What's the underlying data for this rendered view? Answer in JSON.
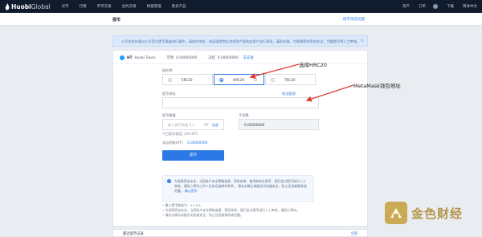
{
  "brand": {
    "name": "Huobi",
    "name_suffix": "Global"
  },
  "nav": {
    "items": [
      "买币",
      "行情",
      "币币交易",
      "合约交易",
      "财富管理",
      "更多产品"
    ],
    "right": [
      "资产",
      "订单",
      "下载",
      "简体中文"
    ]
  },
  "page": {
    "title": "提币",
    "help_link": "提币常见问题"
  },
  "notice": {
    "text": "火币仅支持通过火币官方提币渠道进行操作，请核对地址，若因填错地址造成资产损失由用户自行承担，谨防诈骗，为保障您的资金安全，大额提币将人工审核。"
  },
  "coin": {
    "symbol": "HT",
    "name": "Huobi Token",
    "available_label": "可用",
    "available_value": "0.00000000",
    "frozen_label": "冻结",
    "frozen_value": "0.00000000",
    "recharge_link": "去充值"
  },
  "form": {
    "chain_label": "链名称",
    "chains": [
      {
        "label": "ERC20",
        "selected": false
      },
      {
        "label": "HRC20",
        "selected": true
      },
      {
        "label": "TRC20",
        "selected": false
      }
    ],
    "address_label": "提币地址",
    "address_manage": "地址管理",
    "address_placeholder": "",
    "amount_label": "提币数量",
    "amount_placeholder": "最小提币数量 0.2",
    "amount_all": "全部",
    "amount_unit": "HT",
    "fee_label": "手续费",
    "fee_value": "0.00000000",
    "quota_label": "今日剩余额度",
    "quota_value": "200 BTC",
    "received_label": "实际到账(HT)",
    "received_value": "0.00000000",
    "submit_label": "提币"
  },
  "tip": {
    "text_a": "为保障资金安全，当您账户安全策略变更、密码修改、使用新地址提币，我们会对提币进行人工审核，请耐心等待工作人员电话或邮件联系。",
    "text_b": "请务必确认电脑及浏览器安全，防止信息被篡改或泄露。",
    "highlight": "确认提币"
  },
  "notes": [
    "• 最小提币数量为：0.2 HT。",
    "• 为保障资金安全，当您账户安全策略变更、密码修改，我们会对提币进行人工审核，请耐心等待。",
    "• 请务必确认电脑及浏览器安全，防止信息被篡改或泄露。"
  ],
  "footer_card": {
    "title": "最近提币记录",
    "link": "全部"
  },
  "annotations": {
    "chain": "选择HRC20",
    "address": "MetaMask钱包地址"
  },
  "watermark": {
    "text": "金色财经"
  },
  "colors": {
    "nav_bg": "#101c2d",
    "accent": "#2c78e6",
    "annotation_arrow": "#e23b2e",
    "watermark": "#b39648"
  }
}
